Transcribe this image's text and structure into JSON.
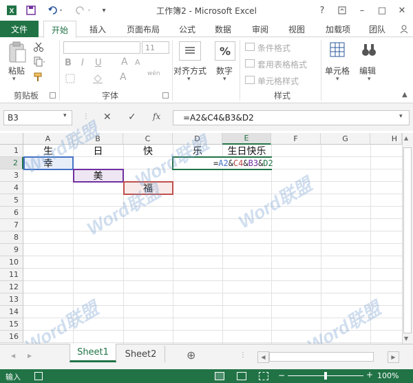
{
  "window": {
    "title": "工作簿2 - Microsoft Excel"
  },
  "titlebar_buttons": [
    "?",
    "▢",
    "–",
    "□",
    "✕"
  ],
  "tabs": [
    {
      "label": "文件"
    },
    {
      "label": "开始"
    },
    {
      "label": "插入"
    },
    {
      "label": "页面布局"
    },
    {
      "label": "公式"
    },
    {
      "label": "数据"
    },
    {
      "label": "审阅"
    },
    {
      "label": "视图"
    },
    {
      "label": "加载项"
    },
    {
      "label": "团队"
    }
  ],
  "ribbon": {
    "clipboard": {
      "paste": "粘贴",
      "group": "剪贴板"
    },
    "font": {
      "font_size": "11",
      "bold": "B",
      "italic": "I",
      "underline": "U",
      "group": "字体",
      "grow": "A",
      "wen": "wén"
    },
    "alignment": {
      "label": "对齐方式"
    },
    "number": {
      "label": "数字",
      "percent": "%"
    },
    "styles": {
      "conditional": "条件格式",
      "table": "套用表格格式",
      "cell_styles": "单元格样式",
      "group": "样式"
    },
    "cells": {
      "label": "单元格"
    },
    "editing": {
      "label": "编辑"
    }
  },
  "formula_bar": {
    "name_box": "B3",
    "formula": "=A2&C4&B3&D2",
    "fx": "fx"
  },
  "columns": [
    "A",
    "B",
    "C",
    "D",
    "E",
    "F",
    "G",
    "H"
  ],
  "rows": [
    "1",
    "2",
    "3",
    "4",
    "5",
    "6",
    "7",
    "8",
    "9",
    "10",
    "11",
    "12",
    "13",
    "14",
    "15",
    "16"
  ],
  "cells": {
    "A1": "生",
    "B1": "日",
    "C1": "快",
    "D1": "乐",
    "E1": "生日快乐",
    "A2": "幸",
    "B3": "美",
    "C4": "福"
  },
  "formula_in_cell": {
    "eq": "=",
    "a2": "A2",
    "amp1": "&",
    "c4": "C4",
    "amp2": "&",
    "b3": "B3",
    "amp3": "&",
    "d2": "D2"
  },
  "sheets": [
    {
      "name": "Sheet1",
      "active": true
    },
    {
      "name": "Sheet2",
      "active": false
    }
  ],
  "add_sheet": "⊕",
  "status": {
    "mode": "输入",
    "zoom": "100%"
  },
  "watermarks": [
    "Word联盟",
    "Word联盟",
    "Word联盟",
    "Word联盟",
    "Word联盟",
    "Word联盟"
  ],
  "colors": {
    "accent": "#217346",
    "ref_blue": "#4472c4",
    "ref_purple": "#7030a0",
    "ref_red": "#c0504d",
    "ref_green": "#217346"
  }
}
